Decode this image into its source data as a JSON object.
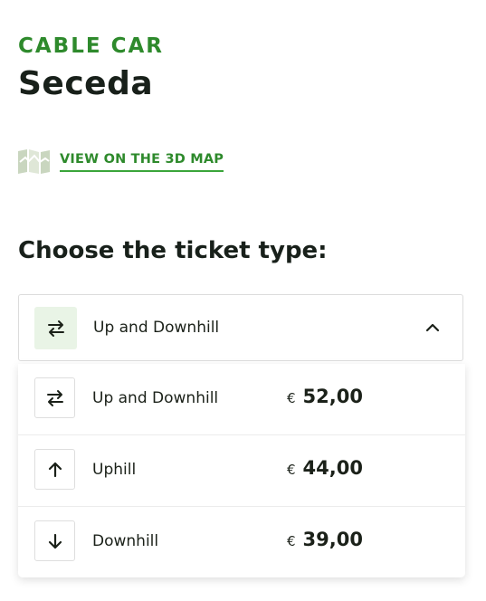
{
  "header": {
    "eyebrow": "CABLE CAR",
    "title": "Seceda"
  },
  "map_link": {
    "label": "VIEW ON THE 3D MAP",
    "icon": "map-icon"
  },
  "ticket_select": {
    "heading": "Choose the ticket type:",
    "selected_label": "Up and Downhill",
    "selected_icon": "swap-arrows-icon",
    "toggle_icon": "chevron-up-icon",
    "expanded": true
  },
  "options": [
    {
      "label": "Up and Downhill",
      "currency": "€",
      "price": "52,00",
      "icon": "swap-arrows-icon"
    },
    {
      "label": "Uphill",
      "currency": "€",
      "price": "44,00",
      "icon": "arrow-up-icon"
    },
    {
      "label": "Downhill",
      "currency": "€",
      "price": "39,00",
      "icon": "arrow-down-icon"
    }
  ],
  "colors": {
    "accent_green": "#2e8a2c",
    "link_underline": "#3aa53a",
    "selected_icon_bg": "#e9f4e6",
    "text_dark": "#18201a"
  }
}
